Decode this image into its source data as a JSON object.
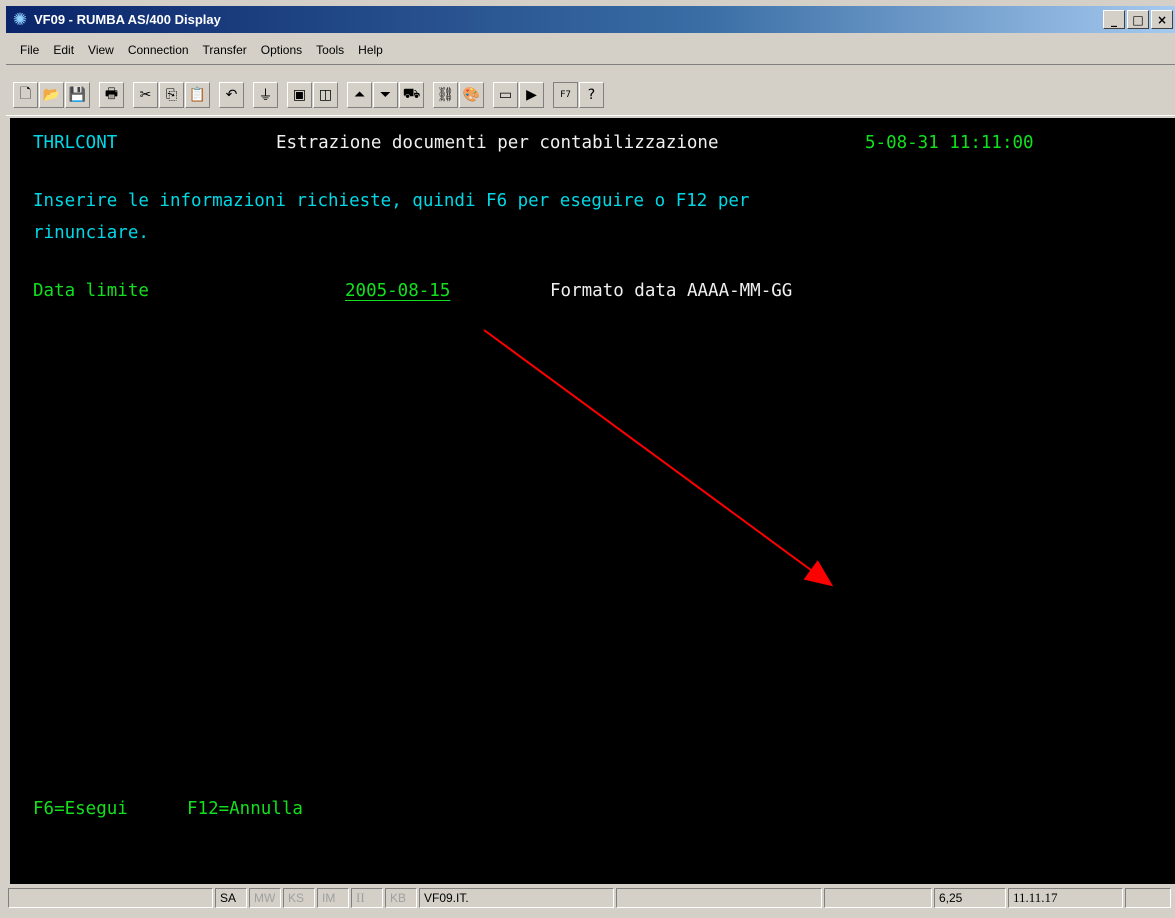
{
  "window": {
    "title": "VF09 - RUMBA AS/400 Display",
    "app_icon": "rumba-app-icon",
    "controls": [
      "_",
      "□",
      "×"
    ]
  },
  "menu": [
    {
      "label": "File"
    },
    {
      "label": "Edit"
    },
    {
      "label": "View"
    },
    {
      "label": "Connection"
    },
    {
      "label": "Transfer"
    },
    {
      "label": "Options"
    },
    {
      "label": "Tools"
    },
    {
      "label": "Help"
    }
  ],
  "toolbar": {
    "buttons": [
      {
        "icon": "new-icon",
        "glyph": "🗋"
      },
      {
        "icon": "open-icon",
        "glyph": "📂"
      },
      {
        "icon": "save-icon",
        "glyph": "💾"
      },
      {
        "icon": "print-icon",
        "glyph": "🖶"
      },
      {
        "icon": "cut-icon",
        "glyph": "✂"
      },
      {
        "icon": "copy-icon",
        "glyph": "⎘"
      },
      {
        "icon": "paste-icon",
        "glyph": "📋"
      },
      {
        "icon": "undo-icon",
        "glyph": "↶"
      },
      {
        "icon": "connect-icon",
        "glyph": "⏚"
      },
      {
        "icon": "window-icon",
        "glyph": "▣"
      },
      {
        "icon": "window-alt-icon",
        "glyph": "◫"
      },
      {
        "icon": "upload-icon",
        "glyph": "⏶"
      },
      {
        "icon": "download-icon",
        "glyph": "⏷"
      },
      {
        "icon": "transfer-icon",
        "glyph": "⛟"
      },
      {
        "icon": "link-icon",
        "glyph": "⛓"
      },
      {
        "icon": "palette-icon",
        "glyph": "🎨"
      },
      {
        "icon": "record-icon",
        "glyph": "▭"
      },
      {
        "icon": "play-icon",
        "glyph": "▶"
      },
      {
        "icon": "f7-key-icon",
        "glyph": "F7"
      },
      {
        "icon": "help-pointer-icon",
        "glyph": "?"
      }
    ]
  },
  "terminal": {
    "program": "THRLCONT",
    "heading": "Estrazione documenti per contabilizzazione",
    "datetime": "5-08-31 11:11:00",
    "instruction_line1": "Inserire le informazioni richieste, quindi F6 per eseguire o F12 per",
    "instruction_line2": "rinunciare.",
    "field_label": "Data limite",
    "field_value": "2005-08-15",
    "field_hint": "Formato data AAAA-MM-GG",
    "fkeys_f6": "F6=Esegui",
    "fkeys_f12": "F12=Annulla",
    "annotation_color": "#ff0000"
  },
  "status": {
    "sa": "SA",
    "mw": "MW",
    "ks": "KS",
    "im": "IM",
    "ii": "II",
    "kb": "KB",
    "session": "VF09.IT.",
    "cursor": "6,25",
    "time": "11.11.17"
  }
}
